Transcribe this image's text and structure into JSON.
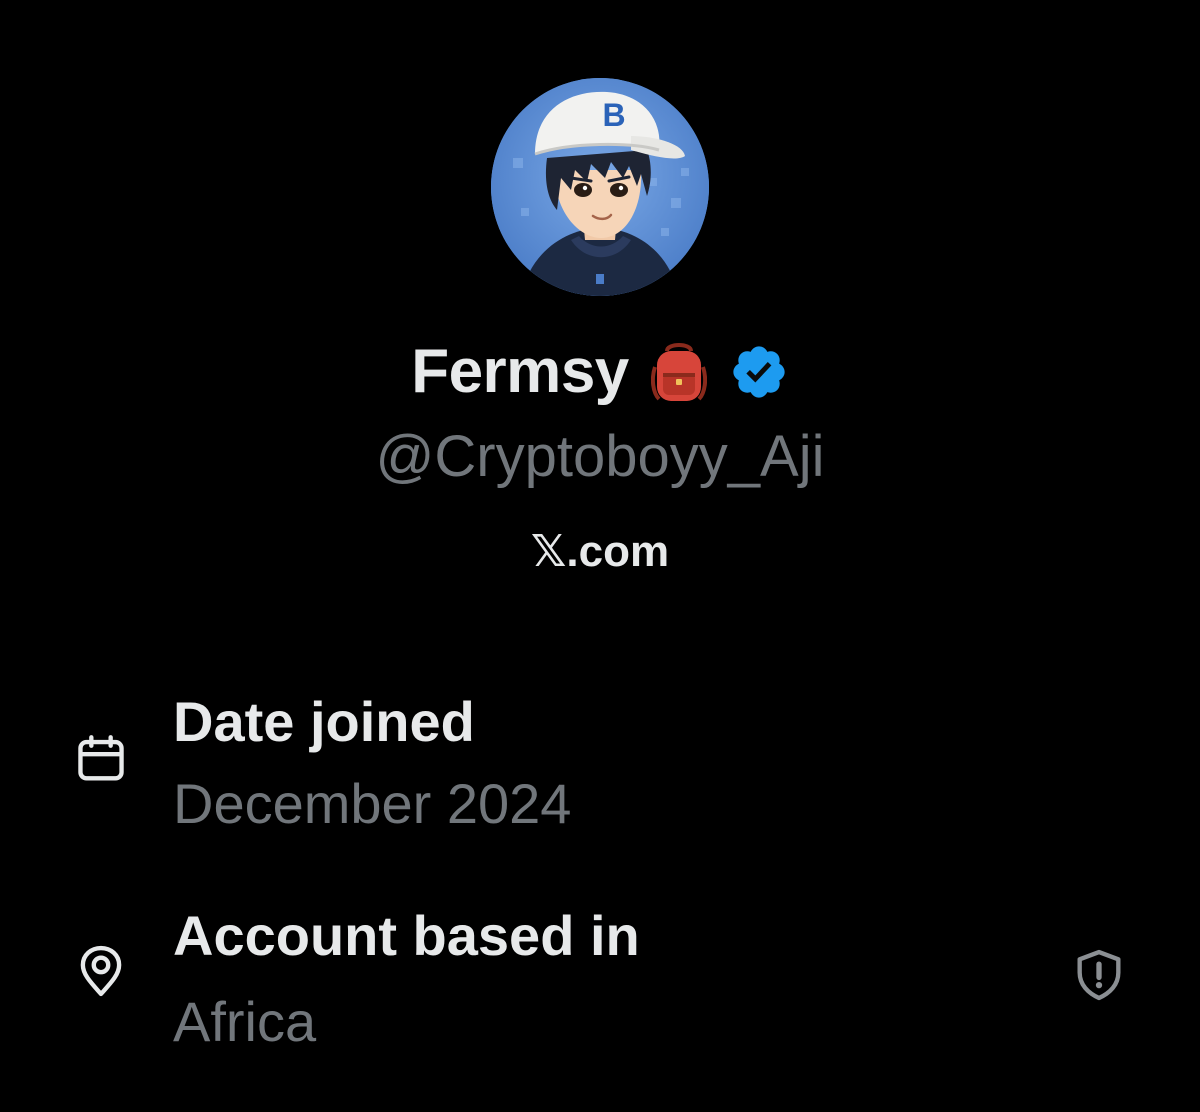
{
  "profile": {
    "display_name": "Fermsy",
    "handle": "@Cryptoboyy_Aji",
    "avatar_letter": "B",
    "verified": true
  },
  "site": {
    "label": "𝕏.com"
  },
  "about": {
    "items": [
      {
        "icon": "calendar-icon",
        "label": "Date joined",
        "value": "December 2024"
      },
      {
        "icon": "location-pin-icon",
        "label": "Account based in",
        "value": "Africa",
        "badge_icon": "shield-alert-icon"
      }
    ]
  },
  "colors": {
    "background": "#000000",
    "primary_text": "#e7e9ea",
    "secondary_text": "#71767b",
    "verified_blue": "#1d9bf0"
  }
}
